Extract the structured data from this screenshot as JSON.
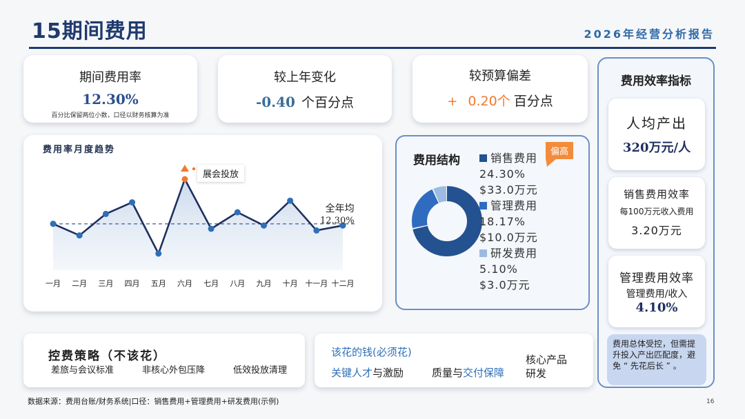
{
  "header": {
    "title": "15期间费用",
    "report": "2026年经营分析报告"
  },
  "kpis": [
    {
      "label": "期间费用率",
      "value": "12.30%",
      "note": "百分比保留两位小数，口径以财务核算为准"
    },
    {
      "label": "较上年变化",
      "value": "-0.40",
      "unit": "个百分点"
    },
    {
      "label": "较预算偏差",
      "sign": "+",
      "value": "0.20个",
      "unit": "百分点"
    }
  ],
  "trend": {
    "title": "费用率月度趋势",
    "annotation": "展会投放",
    "avg_label": "全年均",
    "avg_value": "12.30%"
  },
  "chart_data": {
    "type": "line",
    "categories": [
      "一月",
      "二月",
      "三月",
      "四月",
      "五月",
      "六月",
      "七月",
      "八月",
      "九月",
      "十月",
      "十一月",
      "十二月"
    ],
    "values": [
      12.3,
      11.6,
      12.9,
      13.6,
      10.5,
      15.0,
      12.0,
      13.0,
      12.2,
      13.7,
      11.9,
      12.2
    ],
    "average": 12.3,
    "ylim": [
      9.5,
      16.0
    ],
    "colors": {
      "line": "#1f2f5e",
      "point": "#2e6fb8",
      "highlight": "#ef7a2e",
      "avg": "#4a6fa0"
    }
  },
  "structure": {
    "title": "费用结构",
    "badge": "偏高",
    "items": [
      {
        "name": "销售费用",
        "pct": "24.30%",
        "amount": "$33.0万元",
        "color": "#24518f"
      },
      {
        "name": "管理费用",
        "pct": "18.17%",
        "amount": "$10.0万元",
        "color": "#2f6cc0"
      },
      {
        "name": "研发费用",
        "pct": "5.10%",
        "amount": "$3.0万元",
        "color": "#9cbbe2"
      }
    ],
    "donut_values": [
      33.0,
      10.0,
      3.0
    ]
  },
  "strategy": {
    "title": "控费策略（不该花）",
    "items": [
      "差旅与会议标准",
      "非核心外包压降",
      "低效投放清理"
    ]
  },
  "must_spend": {
    "title": "该花的钱(必须花)",
    "item1_a": "关键人才",
    "item1_b": "与激励",
    "item2_a": "质量与",
    "item2_b": "交付保障",
    "item3_line1": "核心产品",
    "item3_line2": "研发"
  },
  "side": {
    "title": "费用效率指标",
    "card1_label": "人均产出",
    "card1_value": "320万元/人",
    "card2_label": "销售费用效率",
    "card2_sub": "每100万元收入费用",
    "card2_value": "3.20万元",
    "card3_label": "管理费用效率",
    "card3_sub": "管理费用/收入",
    "card3_value": "4.10%",
    "note": "费用总体受控，但需提升投入产出匹配度，避免 “ 先花后长 ” 。"
  },
  "footer": {
    "source": "数据来源：费用台账/财务系统|口径：销售费用+管理费用+研发费用(示例)",
    "page": "16"
  }
}
